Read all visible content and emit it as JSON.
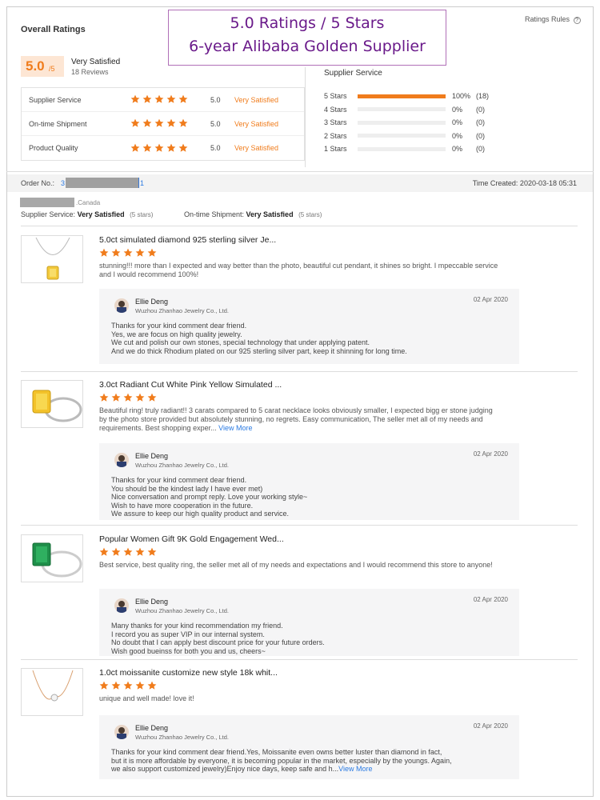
{
  "banner": {
    "line1": "5.0 Ratings / 5 Stars",
    "line2": "6-year Alibaba Golden Supplier"
  },
  "overall": {
    "title": "Overall Ratings",
    "rules_label": "Ratings Rules",
    "rules_icon": "question-icon",
    "score": "5.0",
    "score_suffix": "/5",
    "summary": "Very Satisfied",
    "reviews_count": "18 Reviews",
    "star_rating": 5,
    "rows": [
      {
        "label": "Supplier Service",
        "value": "5.0",
        "status": "Very Satisfied",
        "stars": 5
      },
      {
        "label": "On-time Shipment",
        "value": "5.0",
        "status": "Very Satisfied",
        "stars": 5
      },
      {
        "label": "Product Quality",
        "value": "5.0",
        "status": "Very Satisfied",
        "stars": 5
      }
    ]
  },
  "supplier_service": {
    "title": "Supplier Service",
    "bars": [
      {
        "label": "5 Stars",
        "percent": "100%",
        "count": "(18)",
        "fill_fraction": 1.0
      },
      {
        "label": "4 Stars",
        "percent": "0%",
        "count": "(0)",
        "fill_fraction": 0
      },
      {
        "label": "3 Stars",
        "percent": "0%",
        "count": "(0)",
        "fill_fraction": 0
      },
      {
        "label": "2 Stars",
        "percent": "0%",
        "count": "(0)",
        "fill_fraction": 0
      },
      {
        "label": "1 Stars",
        "percent": "0%",
        "count": "(0)",
        "fill_fraction": 0
      }
    ],
    "accent_color": "#f07c1c"
  },
  "order": {
    "label": "Order No.:",
    "number_visible_start": "3",
    "number_visible_end": "1",
    "time_created": "Time Created: 2020-03-18 05:31"
  },
  "buyer": {
    "country": ".Canada",
    "supplier_service_label": "Supplier Service:",
    "supplier_service_value": "Very Satisfied",
    "supplier_service_stars": "(5 stars)",
    "shipment_label": "On-time Shipment:",
    "shipment_value": "Very Satisfied",
    "shipment_stars": "(5 stars)"
  },
  "reviews": [
    {
      "product": "5.0ct simulated diamond 925 sterling silver Je...",
      "stars": 5,
      "text": "stunning!!! more than I expected and way better than the photo, beautiful cut pendant, it shines so bright. I mpeccable service and I would recommend 100%!",
      "more": "",
      "reply": {
        "name": "Ellie Deng",
        "company": "Wuzhou Zhanhao Jewelry Co., Ltd.",
        "date": "02 Apr 2020",
        "lines": [
          "Thanks for your kind comment dear friend.",
          "Yes, we are focus on high quality jewelry.",
          "We cut and polish our own stones, special technology that under applying patent.",
          "And we do thick Rhodium plated on our 925 sterling silver part, keep it shinning for long time."
        ]
      }
    },
    {
      "product": "3.0ct Radiant Cut White Pink Yellow Simulated ...",
      "stars": 5,
      "text": "Beautiful ring! truly radiant!! 3 carats compared to 5 carat necklace looks obviously smaller, I expected bigg er stone judging by the photo store provided but absolutely stunning, no regrets. Easy communication, The seller met all of my needs and requirements. Best shopping exper...",
      "more": "View More",
      "reply": {
        "name": "Ellie Deng",
        "company": "Wuzhou Zhanhao Jewelry Co., Ltd.",
        "date": "02 Apr 2020",
        "lines": [
          "Thanks for your kind comment dear friend.",
          "You should be the kindest lady I have ever met)",
          "Nice conversation and prompt reply. Love your working style~",
          "Wish to have more cooperation in the future.",
          "We assure to keep our high quality product and service."
        ]
      }
    },
    {
      "product": "Popular Women Gift 9K Gold Engagement Wed...",
      "stars": 5,
      "text": "Best service, best quality ring, the seller met all of my needs and expectations and I would recommend this store to anyone!",
      "more": "",
      "reply": {
        "name": "Ellie Deng",
        "company": "Wuzhou Zhanhao Jewelry Co., Ltd.",
        "date": "02 Apr 2020",
        "lines": [
          "Many thanks for your kind recommendation my friend.",
          "I record you as super VIP in our internal system.",
          "No doubt that I can apply best discount price for your future orders.",
          "Wish good bueinss for both you and us, cheers~"
        ]
      }
    },
    {
      "product": "1.0ct moissanite customize new style 18k whit...",
      "stars": 5,
      "text": "unique and well made! love it!",
      "more": "",
      "reply": {
        "name": "Ellie Deng",
        "company": "Wuzhou Zhanhao Jewelry Co., Ltd.",
        "date": "02 Apr 2020",
        "lines": [
          "Thanks for your kind comment dear friend.Yes, Moissanite even owns better luster than diamond in fact,",
          "but it is more affordable by everyone, it is becoming popular in the market, especially by the youngs. Again,",
          "we also support customized jewelry)Enjoy nice days, keep safe and h..."
        ],
        "more": "View More"
      }
    }
  ]
}
